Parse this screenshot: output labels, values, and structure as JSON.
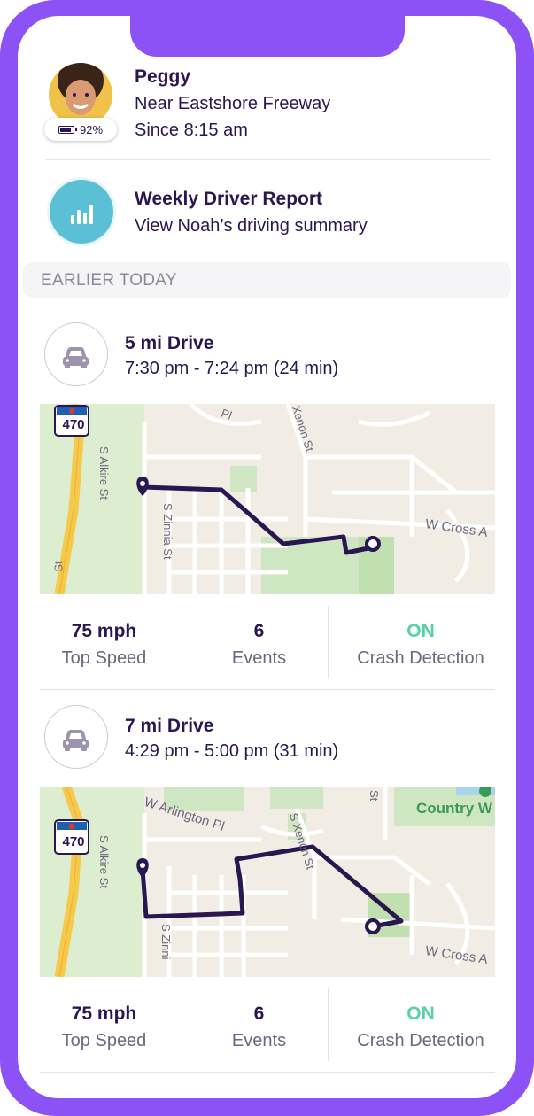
{
  "person": {
    "name": "Peggy",
    "location": "Near Eastshore Freeway",
    "since": "Since 8:15 am",
    "battery": "92%"
  },
  "report": {
    "title": "Weekly Driver Report",
    "subtitle": "View Noah’s driving summary"
  },
  "section_label": "EARLIER TODAY",
  "drives": [
    {
      "title": "5 mi Drive",
      "time": "7:30 pm - 7:24 pm (24 min)",
      "map_labels": {
        "hwy": "470",
        "s_alkire": "S Alkire St",
        "s_zinnia": "S Zinnia St",
        "xenon": "Xenon St",
        "w_cross": "W Cross A",
        "top_pl": "Pl",
        "side_st": "St"
      },
      "stats": [
        {
          "value": "75 mph",
          "label": "Top Speed"
        },
        {
          "value": "6",
          "label": "Events"
        },
        {
          "value": "ON",
          "label": "Crash Detection"
        }
      ]
    },
    {
      "title": "7 mi Drive",
      "time": "4:29 pm - 5:00 pm (31 min)",
      "map_labels": {
        "hwy": "470",
        "s_alkire": "S Alkire St",
        "s_zinnia": "S Zinni",
        "xenon": "S Xenon St",
        "w_cross": "W Cross A",
        "w_arlington": "W Arlington Pl",
        "country": "Country W",
        "side_st": "St"
      },
      "stats": [
        {
          "value": "75 mph",
          "label": "Top Speed"
        },
        {
          "value": "6",
          "label": "Events"
        },
        {
          "value": "ON",
          "label": "Crash Detection"
        }
      ]
    }
  ],
  "colors": {
    "frame": "#8c52f5",
    "text": "#2a1650",
    "on_status": "#56d1a8",
    "route": "#2a1650",
    "report_icon": "#5bc0d6"
  }
}
